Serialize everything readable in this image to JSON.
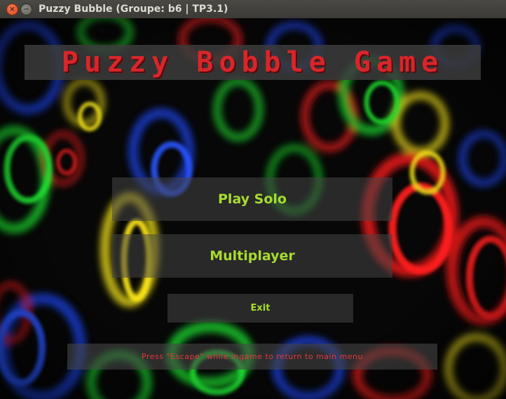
{
  "window": {
    "title": "Puzzy Bubble (Groupe: b6 | TP3.1)",
    "close_glyph": "×",
    "minimize_glyph": "−"
  },
  "game": {
    "logo_text": "Puzzy Bobble Game",
    "menu": {
      "play_solo": "Play Solo",
      "multiplayer": "Multiplayer",
      "exit": "Exit"
    },
    "hint": "Press \"Escape\" while ingame to return to main menu"
  },
  "colors": {
    "logo_red": "#d8262b",
    "menu_green": "#a7dc2f",
    "hint_red": "#e03a3a"
  }
}
